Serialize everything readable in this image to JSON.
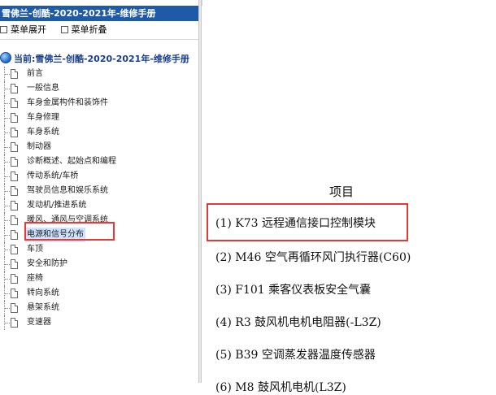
{
  "left_pane": {
    "title": "雪佛兰-创酷-2020-2021年-维修手册",
    "menu": {
      "expand_label": "菜单展开",
      "collapse_label": "菜单折叠"
    },
    "root_label": "当前:雪佛兰-创酷-2020-2021年-维修手册",
    "items": [
      {
        "label": "前言"
      },
      {
        "label": "一般信息"
      },
      {
        "label": "车身金属构件和装饰件"
      },
      {
        "label": "车身修理"
      },
      {
        "label": "车身系统"
      },
      {
        "label": "制动器"
      },
      {
        "label": "诊断概述、起始点和编程"
      },
      {
        "label": "传动系统/车桥"
      },
      {
        "label": "驾驶员信息和娱乐系统"
      },
      {
        "label": "发动机/推进系统"
      },
      {
        "label": "暖风、通风与空调系统"
      },
      {
        "label": "电源和信号分布"
      },
      {
        "label": "车顶"
      },
      {
        "label": "安全和防护"
      },
      {
        "label": "座椅"
      },
      {
        "label": "转向系统"
      },
      {
        "label": "悬架系统"
      },
      {
        "label": "变速器"
      }
    ],
    "selected_index": 11
  },
  "content": {
    "heading": "项目",
    "items": [
      "(1) K73 远程通信接口控制模块",
      "(2) M46 空气再循环风门执行器(C60)",
      "(3) F101 乘客仪表板安全气囊",
      "(4) R3 鼓风机电机电阻器(-L3Z)",
      "(5) B39 空调蒸发器温度传感器",
      "(6) M8 鼓风机电机(L3Z)"
    ]
  },
  "colors": {
    "titlebar": "#1f5aa6",
    "highlight": "#e53935",
    "root_text": "#1a3f8a"
  }
}
